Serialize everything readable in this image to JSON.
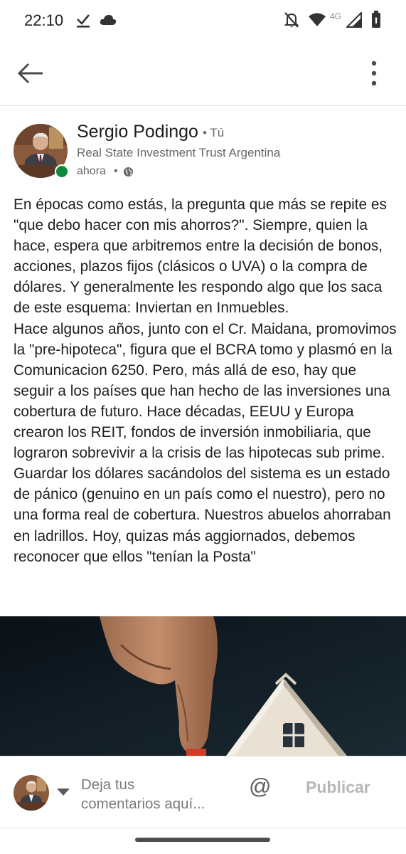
{
  "status_bar": {
    "time": "22:10",
    "network_label": "4G",
    "icons": [
      "check-download-icon",
      "cloud-icon",
      "notifications-off-icon",
      "wifi-icon",
      "cellular-signal-icon",
      "battery-icon"
    ]
  },
  "app_bar": {
    "icons": [
      "back-arrow-icon",
      "more-vert-icon"
    ]
  },
  "post": {
    "author_name": "Sergio Podingo",
    "author_badge": "• Tú",
    "author_headline": "Real State Investment Trust Argentina",
    "time": "ahora",
    "separator": "•",
    "visibility_icon": "globe-icon",
    "body": "En épocas como estás, la pregunta que más se repite es \"que debo hacer con mis ahorros?\". Siempre, quien la hace, espera que arbitremos entre la decisión de bonos, acciones, plazos fijos (clásicos o UVA) o la compra de dólares. Y generalmente les respondo algo que los saca de este esquema: Inviertan en Inmuebles.\nHace algunos años, junto con el Cr. Maidana, promovimos la \"pre-hipoteca\", figura que el BCRA tomo y plasmó en la Comunicacion 6250. Pero, más allá de eso, hay que seguir a los países que han hecho de las inversiones una cobertura de futuro. Hace décadas, EEUU y Europa crearon los REIT, fondos de inversión inmobiliaria, que lograron sobrevivir a la crisis de las hipotecas sub prime. Guardar los dólares sacándolos del sistema es un estado de pánico (genuino en un país como el nuestro), pero no una forma real de cobertura. Nuestros abuelos ahorraban en ladrillos. Hoy, quizas más aggiornados, debemos reconocer que ellos \"tenían la Posta\""
  },
  "comment_bar": {
    "placeholder": "Deja tus\ncomentarios aquí...",
    "mention_symbol": "@",
    "publish_label": "Publicar"
  },
  "colors": {
    "online": "#0c8b3a",
    "publish_disabled": "#b7b7b7",
    "text": "#1e1e1e"
  }
}
